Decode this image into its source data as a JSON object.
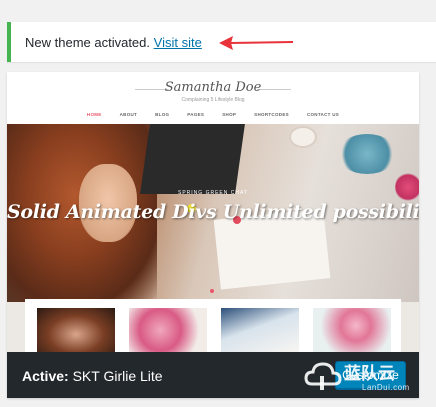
{
  "notice": {
    "message": "New theme activated.",
    "link_label": "Visit site",
    "accent_color": "#46b450",
    "arrow_color": "#e8333a"
  },
  "theme_preview": {
    "site_logo": "Samantha Doe",
    "site_tagline": "Complaining 5 Lifestyle Blog",
    "nav_items": [
      "HOME",
      "ABOUT",
      "BLOG",
      "PAGES",
      "SHOP",
      "SHORTCODES",
      "CONTACT US"
    ],
    "hero_kicker": "SPRING GREEN CHAT",
    "hero_title": "Solid Animated Divs Unlimited possibilities"
  },
  "theme_bar": {
    "active_prefix": "Active:",
    "theme_name": "SKT Girlie Lite",
    "customize_label": "Customize"
  },
  "watermark": {
    "brand_cn": "蓝队云",
    "brand_en": "LanDui.com"
  }
}
